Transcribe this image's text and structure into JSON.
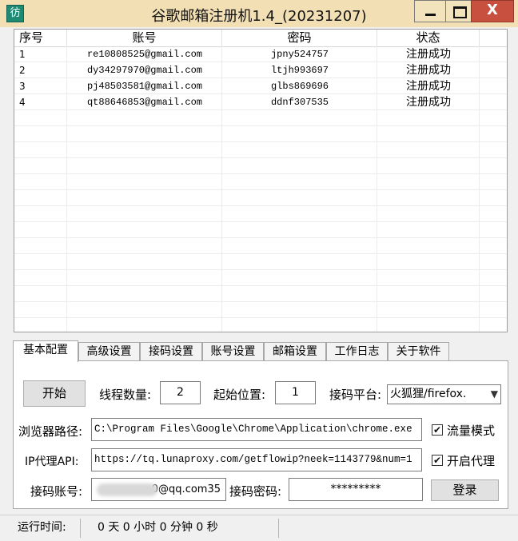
{
  "window": {
    "title": "谷歌邮箱注册机1.4_(20231207)",
    "icon_glyph": "彷",
    "minimize_glyph": "_",
    "maximize_glyph": "□",
    "close_glyph": "X"
  },
  "table": {
    "columns": [
      "序号",
      "账号",
      "密码",
      "状态"
    ],
    "rows": [
      {
        "index": "1",
        "account": "re10808525@gmail.com",
        "password": "jpny524757",
        "status": "注册成功"
      },
      {
        "index": "2",
        "account": "dy34297970@gmail.com",
        "password": "ltjh993697",
        "status": "注册成功"
      },
      {
        "index": "3",
        "account": "pj48503581@gmail.com",
        "password": "glbs869696",
        "status": "注册成功"
      },
      {
        "index": "4",
        "account": "qt88646853@gmail.com",
        "password": "ddnf307535",
        "status": "注册成功"
      }
    ]
  },
  "tabs": [
    "基本配置",
    "高级设置",
    "接码设置",
    "账号设置",
    "邮箱设置",
    "工作日志",
    "关于软件"
  ],
  "config": {
    "start_button": "开始",
    "threads_label": "线程数量:",
    "threads_value": "2",
    "start_pos_label": "起始位置:",
    "start_pos_value": "1",
    "platform_label": "接码平台:",
    "platform_value": "火狐狸/firefox.",
    "browser_label": "浏览器路径:",
    "browser_value": "C:\\Program Files\\Google\\Chrome\\Application\\chrome.exe",
    "flow_mode_label": "流量模式",
    "flow_mode_checked": true,
    "proxy_label": "IP代理API:",
    "proxy_value": "https://tq.lunaproxy.com/getflowip?neek=1143779&num=1",
    "enable_proxy_label": "开启代理",
    "enable_proxy_checked": true,
    "sms_account_label": "接码账号:",
    "sms_account_visible": "0@qq.com35",
    "sms_password_label": "接码密码:",
    "sms_password_value": "*********",
    "login_button": "登录"
  },
  "statusbar": {
    "runtime_label": "运行时间:",
    "runtime_value": "0 天 0 小时 0 分钟 0 秒"
  }
}
